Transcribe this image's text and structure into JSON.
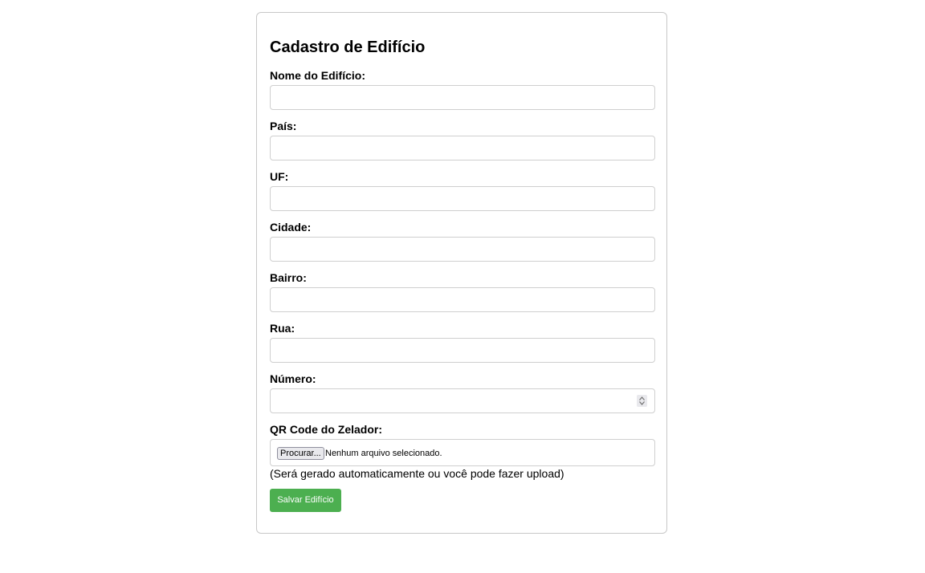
{
  "form": {
    "title": "Cadastro de Edifício",
    "fields": [
      {
        "label": "Nome do Edifício:",
        "value": ""
      },
      {
        "label": "País:",
        "value": ""
      },
      {
        "label": "UF:",
        "value": ""
      },
      {
        "label": "Cidade:",
        "value": ""
      },
      {
        "label": "Bairro:",
        "value": ""
      },
      {
        "label": "Rua:",
        "value": ""
      },
      {
        "label": "Número:",
        "value": ""
      }
    ],
    "qr": {
      "label": "QR Code do Zelador:",
      "button_label": "Procurar...",
      "status": "Nenhum arquivo selecionado.",
      "hint": "(Será gerado automaticamente ou você pode fazer upload)"
    },
    "submit_label": "Salvar Edifício"
  },
  "colors": {
    "accent": "#4caf50",
    "border": "#cfcfcf"
  }
}
